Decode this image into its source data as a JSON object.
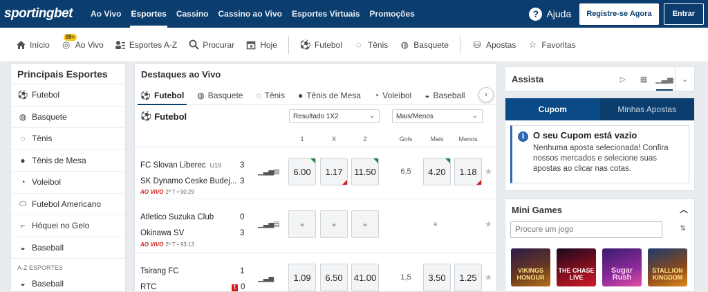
{
  "brand": {
    "logo": "sportingbet"
  },
  "topnav": [
    {
      "label": "Ao Vivo"
    },
    {
      "label": "Esportes",
      "active": true
    },
    {
      "label": "Cassino"
    },
    {
      "label": "Cassino ao Vivo"
    },
    {
      "label": "Esportes Virtuais"
    },
    {
      "label": "Promoções"
    }
  ],
  "header": {
    "help": "Ajuda",
    "register": "Registre-se Agora",
    "login": "Entrar",
    "help_icon": "?"
  },
  "subnav": {
    "inicio": "Início",
    "ao_vivo": "Ao Vivo",
    "ao_vivo_badge": "99+",
    "esportes_az": "Esportes A-Z",
    "procurar": "Procurar",
    "hoje": "Hoje",
    "futebol": "Futebol",
    "tenis": "Tênis",
    "basquete": "Basquete",
    "apostas": "Apostas",
    "favoritas": "Favoritas"
  },
  "sidebar": {
    "title": "Principais Esportes",
    "items": [
      "Futebol",
      "Basquete",
      "Tênis",
      "Tênis de Mesa",
      "Voleibol",
      "Futebol Americano",
      "Hóquei no Gelo",
      "Baseball"
    ],
    "az_label": "A-Z ESPORTES",
    "az_items": [
      "Baseball"
    ]
  },
  "live": {
    "title": "Destaques ao Vivo",
    "tabs": [
      "Futebol",
      "Basquete",
      "Tênis",
      "Tênis de Mesa",
      "Voleibol",
      "Baseball"
    ],
    "section_title": "Futebol",
    "market1": "Resultado 1X2",
    "market2": "Mais/Menos",
    "cols": {
      "c1": "1",
      "cx": "X",
      "c2": "2",
      "gols": "Gols",
      "mais": "Mais",
      "menos": "Menos"
    },
    "live_label": "AO VIVO",
    "matches": [
      {
        "home": "FC Slovan Liberec",
        "home_tag": "U19",
        "away": "SK Dynamo Ceske Budej...",
        "home_score": "3",
        "away_score": "3",
        "time": "2º T • 90:29",
        "o1": "6.00",
        "ox": "1.17",
        "o2": "11.50",
        "gols": "6,5",
        "mais": "4.20",
        "menos": "1.18"
      },
      {
        "home": "Atletico Suzuka Club",
        "away": "Okinawa SV",
        "home_score": "0",
        "away_score": "3",
        "time": "2º T • 93:13"
      },
      {
        "home": "Tsirang FC",
        "away": "RTC",
        "home_score": "1",
        "away_score": "0",
        "away_card": "1",
        "o1": "1.09",
        "ox": "6.50",
        "o2": "41.00",
        "gols": "1,5",
        "mais": "3.50",
        "menos": "1.25"
      }
    ]
  },
  "right": {
    "assista_title": "Assista",
    "betslip_tabs": [
      "Cupom",
      "Minhas Apostas"
    ],
    "betslip_empty_title": "O seu Cupom está vazio",
    "betslip_empty_text": "Nenhuma aposta selecionada! Confira nossos mercados e selecione suas apostas ao clicar nas cotas.",
    "mini_games_title": "Mini Games",
    "search_placeholder": "Procure um jogo",
    "games": [
      "VIKINGS HONOUR",
      "THE CHASE LIVE",
      "Sugar Rush",
      "STALLION KINGDOM"
    ]
  },
  "colors": {
    "brand": "#0b3d6e",
    "up": "#1f8a3a",
    "down": "#d01c1c",
    "info": "#2a66b4"
  }
}
